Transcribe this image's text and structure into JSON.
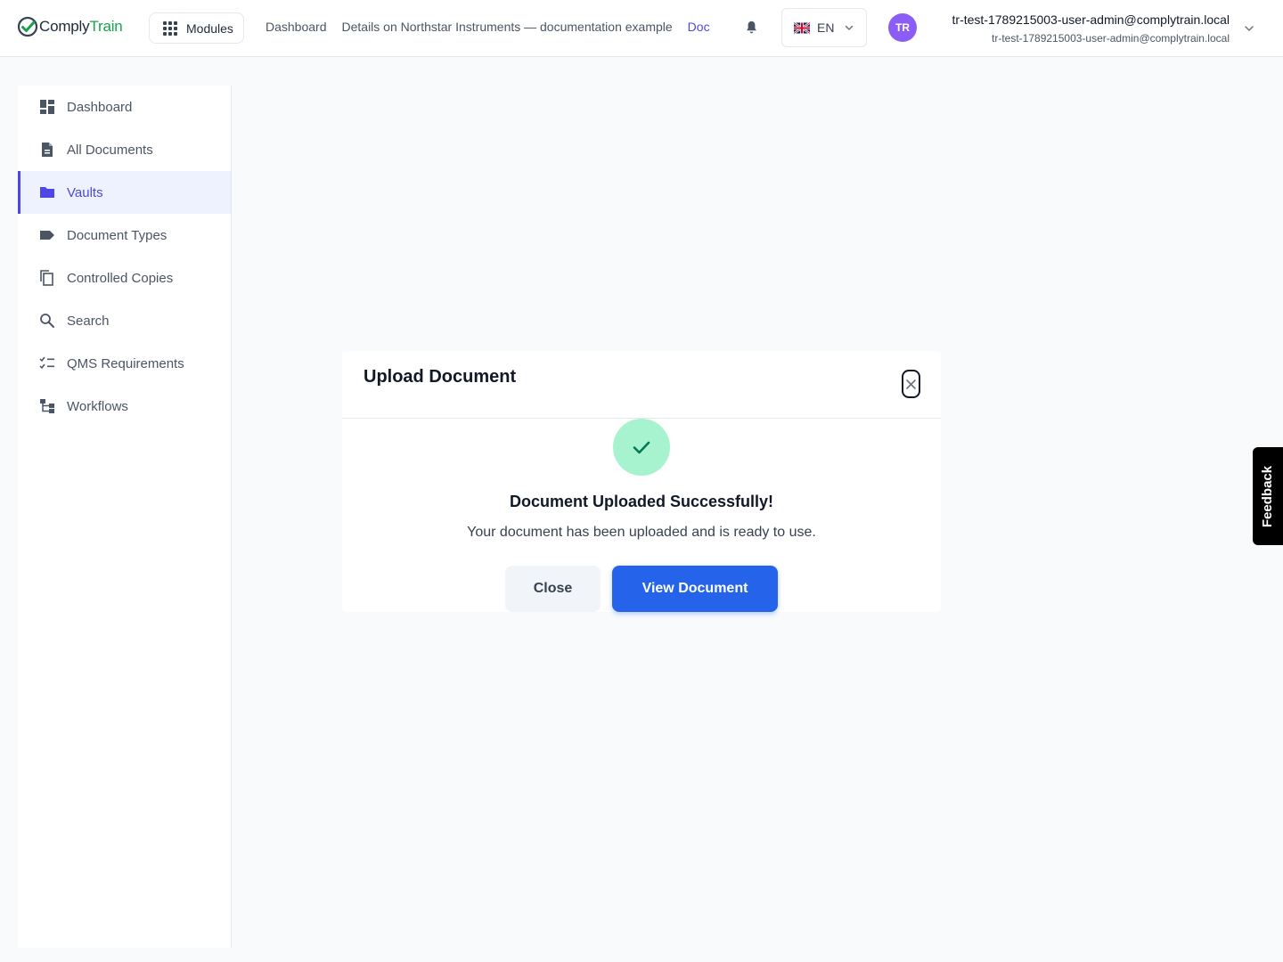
{
  "app": {
    "logo_part1": "Comply",
    "logo_part2": "Train",
    "brand_color": "#16a34a",
    "accent_color": "#4f46e5"
  },
  "header": {
    "modules_label": "Modules",
    "breadcrumbs": [
      "Dashboard",
      "Details on Northstar Instruments — documentation example",
      "Doc"
    ],
    "language": "EN",
    "avatar_initials": "TR",
    "user_name": "tr-test-1789215003-user-admin@complytrain.local",
    "user_email": "tr-test-1789215003-user-admin@complytrain.local"
  },
  "sidebar": {
    "items": [
      {
        "label": "Dashboard",
        "icon": "dashboard-icon"
      },
      {
        "label": "All Documents",
        "icon": "document-icon"
      },
      {
        "label": "Vaults",
        "icon": "folder-icon",
        "active": true
      },
      {
        "label": "Document Types",
        "icon": "tag-icon"
      },
      {
        "label": "Controlled Copies",
        "icon": "copy-icon"
      },
      {
        "label": "Search",
        "icon": "search-icon"
      },
      {
        "label": "QMS Requirements",
        "icon": "checklist-icon"
      },
      {
        "label": "Workflows",
        "icon": "workflow-icon"
      }
    ]
  },
  "modal": {
    "title": "Upload Document",
    "success_title": "Document Uploaded Successfully!",
    "success_text": "Your document has been uploaded and is ready to use.",
    "close_label": "Close",
    "view_label": "View Document",
    "success_color": "#a7f3d0",
    "primary_color": "#2563eb"
  },
  "feedback": {
    "label": "Feedback"
  }
}
